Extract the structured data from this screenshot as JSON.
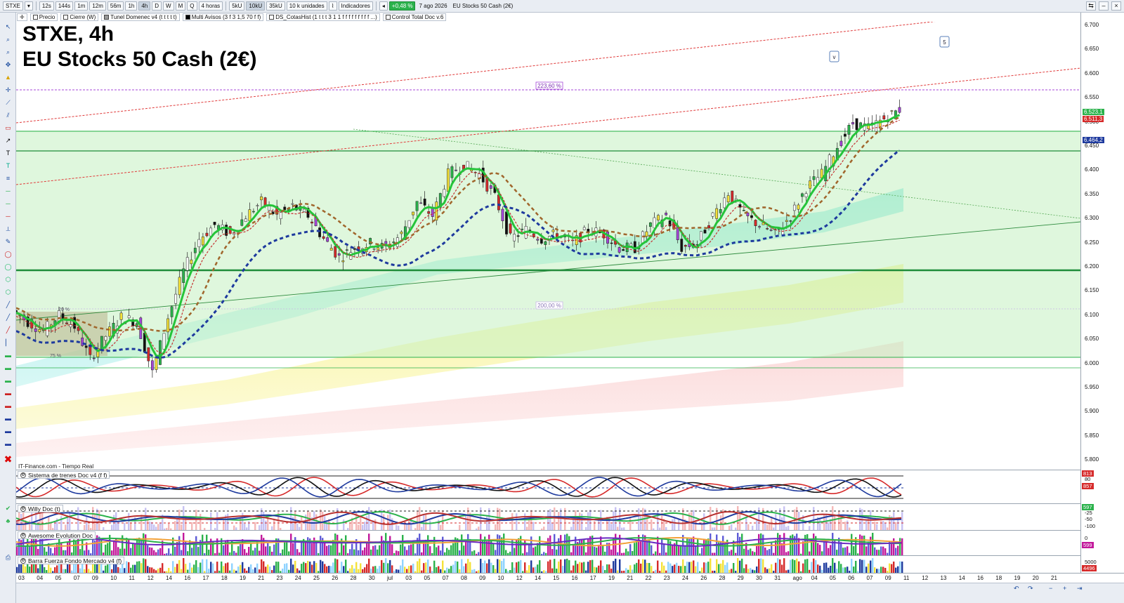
{
  "toolbar": {
    "symbol": "STXE",
    "timeframes": [
      "12s",
      "144s",
      "1m",
      "12m",
      "56m",
      "1h",
      "4h",
      "D",
      "W",
      "M",
      "Q"
    ],
    "active_timeframe": "4h",
    "period_select": "4 horas",
    "tick_buttons": [
      "5kU",
      "10kU",
      "35kU"
    ],
    "active_tick": "10kU",
    "units_select": "10 k unidades",
    "indicators_label": "Indicadores",
    "change_pct": "+0,48 %",
    "date": "7 ago 2026",
    "instrument_name": "EU Stocks 50 Cash (2€)"
  },
  "legend": {
    "items": [
      "Precio",
      "Cierre (W)",
      "Tunel Domenec v4 (t t t t t)",
      "Multi Avisos (3 f 3 1,5 70 f f)",
      "DS_CotasHist (1 t t t 3 1 1 f f f f f f f f f ...)",
      "Control Total Doc v.6"
    ]
  },
  "title": {
    "line1": "STXE, 4h",
    "line2": "EU Stocks 50 Cash (2€)"
  },
  "provider": "IT-Finance.com - Tiempo Real",
  "chart_annotations": {
    "fib_upper": "223,60 %",
    "fib_lower": "200,00 %",
    "box_pct_top": "20 %",
    "box_pct_bottom": "75 %",
    "wave_labels": [
      "v",
      "5"
    ]
  },
  "price_axis": {
    "ticks": [
      "6.700",
      "6.650",
      "6.600",
      "6.550",
      "6.500",
      "6.450",
      "6.400",
      "6.350",
      "6.300",
      "6.250",
      "6.200",
      "6.150",
      "6.100",
      "6.050",
      "6.000",
      "5.950",
      "5.900",
      "5.850",
      "5.800"
    ],
    "labels": [
      {
        "text": "6.523,1",
        "color": "#2bb24c"
      },
      {
        "text": "6.511,3",
        "color": "#d62a2a"
      },
      {
        "text": "6.464,2",
        "color": "#1e3a9e"
      }
    ]
  },
  "panes": [
    {
      "title": "Sistema de trenes Doc v4 (f f)",
      "ticks": [
        "80"
      ],
      "labels": [
        {
          "text": "813",
          "color": "#d62a2a"
        },
        {
          "text": "857",
          "color": "#d62a2a"
        }
      ]
    },
    {
      "title": "Willy Doc (t)",
      "ticks": [
        "-25",
        "-50",
        "-100"
      ],
      "labels": [
        {
          "text": "597",
          "color": "#2bb24c"
        }
      ]
    },
    {
      "title": "Awesome Evolution Doc",
      "ticks": [
        "0"
      ],
      "labels": [
        {
          "text": "599",
          "color": "#c2189b"
        }
      ]
    },
    {
      "title": "Barra Fuerza Fondo Mercado v4 (f)",
      "ticks": [
        "5000"
      ],
      "labels": [
        {
          "text": "4496",
          "color": "#d62a2a"
        }
      ]
    }
  ],
  "time_axis": [
    "03",
    "04",
    "05",
    "07",
    "09",
    "10",
    "11",
    "12",
    "14",
    "16",
    "17",
    "18",
    "19",
    "21",
    "23",
    "24",
    "25",
    "26",
    "28",
    "30",
    "jul",
    "03",
    "05",
    "07",
    "08",
    "09",
    "10",
    "12",
    "14",
    "15",
    "16",
    "17",
    "19",
    "21",
    "22",
    "23",
    "24",
    "26",
    "28",
    "29",
    "30",
    "31",
    "ago",
    "04",
    "05",
    "06",
    "07",
    "09",
    "11",
    "12",
    "13",
    "14",
    "16",
    "18",
    "19",
    "20",
    "21"
  ],
  "chart_data": {
    "type": "candlestick",
    "symbol": "STXE",
    "timeframe": "4h",
    "ylim": [
      5750,
      6720
    ],
    "levels": {
      "resistance_high": 6480,
      "resistance_mid": 6440,
      "support": 6190,
      "box_low": 6010,
      "fib_223": 6568,
      "fib_200": 6108
    },
    "close_path": [
      [
        0,
        6095
      ],
      [
        1,
        6070
      ],
      [
        2,
        6050
      ],
      [
        3,
        6085
      ],
      [
        4,
        6060
      ],
      [
        5,
        5990
      ],
      [
        6,
        6040
      ],
      [
        7,
        6080
      ],
      [
        8,
        6070
      ],
      [
        9,
        5960
      ],
      [
        10,
        6080
      ],
      [
        11,
        6180
      ],
      [
        12,
        6250
      ],
      [
        13,
        6280
      ],
      [
        14,
        6260
      ],
      [
        15,
        6300
      ],
      [
        16,
        6330
      ],
      [
        17,
        6300
      ],
      [
        18,
        6320
      ],
      [
        19,
        6300
      ],
      [
        20,
        6250
      ],
      [
        21,
        6210
      ],
      [
        22,
        6230
      ],
      [
        23,
        6240
      ],
      [
        24,
        6230
      ],
      [
        25,
        6260
      ],
      [
        26,
        6330
      ],
      [
        27,
        6300
      ],
      [
        28,
        6390
      ],
      [
        29,
        6410
      ],
      [
        30,
        6390
      ],
      [
        31,
        6340
      ],
      [
        32,
        6250
      ],
      [
        33,
        6270
      ],
      [
        34,
        6250
      ],
      [
        35,
        6260
      ],
      [
        36,
        6240
      ],
      [
        37,
        6270
      ],
      [
        38,
        6260
      ],
      [
        39,
        6230
      ],
      [
        40,
        6230
      ],
      [
        41,
        6280
      ],
      [
        42,
        6300
      ],
      [
        43,
        6230
      ],
      [
        44,
        6240
      ],
      [
        45,
        6300
      ],
      [
        46,
        6350
      ],
      [
        47,
        6300
      ],
      [
        48,
        6280
      ],
      [
        49,
        6260
      ],
      [
        50,
        6300
      ],
      [
        51,
        6360
      ],
      [
        52,
        6390
      ],
      [
        53,
        6450
      ],
      [
        54,
        6500
      ],
      [
        55,
        6490
      ],
      [
        56,
        6510
      ],
      [
        57,
        6530
      ]
    ]
  }
}
